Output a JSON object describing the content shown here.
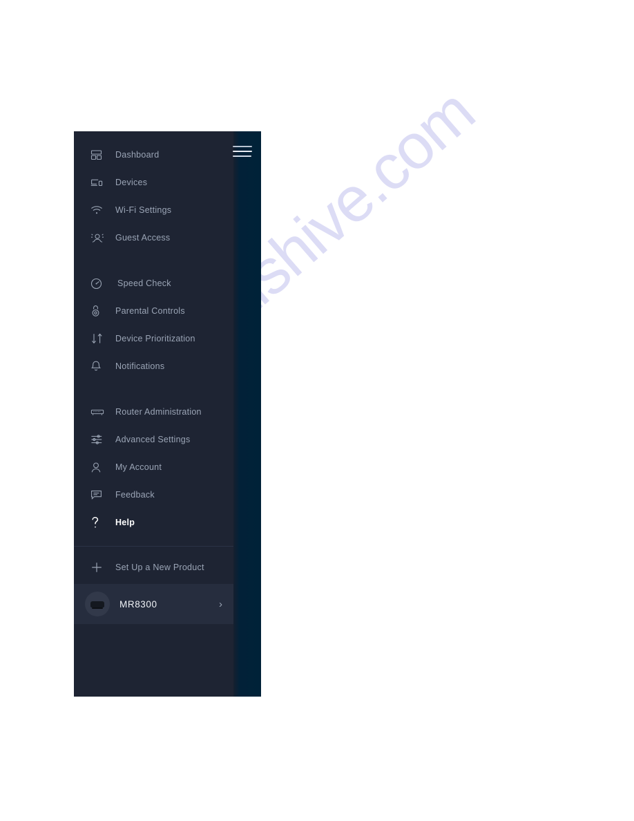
{
  "watermark": {
    "text": "manualshive.com",
    "color": "#c8c8f0"
  },
  "nav": {
    "menu_button": {
      "name": "Menu",
      "icon": "hamburger-icon"
    },
    "theme": {
      "panel_bg": "#1e2433",
      "strip_bg": "#002238",
      "label_color": "#9ba5b6",
      "active_label_color": "#ffffff",
      "selected_row_bg": "#262d3e"
    },
    "groups": [
      {
        "id": "primary",
        "items": [
          {
            "label": "Dashboard",
            "icon": "dashboard-grid-icon",
            "active": false
          },
          {
            "label": "Devices",
            "icon": "devices-icon",
            "active": false
          },
          {
            "label": "Wi-Fi Settings",
            "icon": "wifi-icon",
            "active": false
          },
          {
            "label": "Guest Access",
            "icon": "guest-access-icon",
            "active": false
          }
        ]
      },
      {
        "id": "tools",
        "items": [
          {
            "label": "Speed Check",
            "icon": "speedometer-icon",
            "active": false
          },
          {
            "label": "Parental Controls",
            "icon": "lock-icon",
            "active": false
          },
          {
            "label": "Device Prioritization",
            "icon": "arrows-down-up-icon",
            "active": false
          },
          {
            "label": "Notifications",
            "icon": "bell-icon",
            "active": false
          }
        ]
      },
      {
        "id": "admin",
        "items": [
          {
            "label": "Router Administration",
            "icon": "router-icon",
            "active": false
          },
          {
            "label": "Advanced Settings",
            "icon": "sliders-icon",
            "active": false
          },
          {
            "label": "My Account",
            "icon": "user-icon",
            "active": false
          },
          {
            "label": "Feedback",
            "icon": "chat-bubble-icon",
            "active": false
          },
          {
            "label": "Help",
            "icon": "question-mark-icon",
            "active": true
          }
        ]
      }
    ],
    "setup": {
      "label": "Set Up a New Product",
      "icon": "plus-icon"
    },
    "device": {
      "name": "MR8300",
      "thumbnail": "router-thumbnail",
      "chevron": "chevron-right-icon"
    }
  }
}
